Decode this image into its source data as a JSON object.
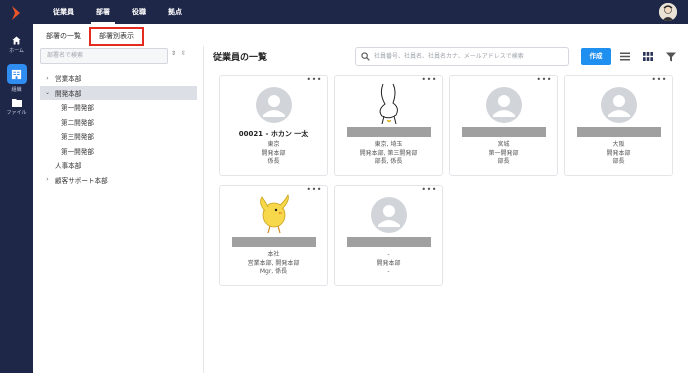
{
  "rail": {
    "items": [
      {
        "label": "ホーム",
        "icon": "home-icon"
      },
      {
        "label": "組織",
        "icon": "org-icon"
      },
      {
        "label": "ファイル",
        "icon": "folder-icon"
      }
    ]
  },
  "topnav": {
    "tabs": [
      "従業員",
      "部署",
      "役職",
      "拠点"
    ],
    "active": "部署"
  },
  "subtabs": {
    "list": "部署の一覧",
    "by_dept": "部署別表示"
  },
  "dept_search": {
    "placeholder": "部署名で検索"
  },
  "tree": [
    {
      "label": "営業本部",
      "expand": "›"
    },
    {
      "label": "開発本部",
      "expand": "⌄"
    },
    {
      "label": "第一開発部"
    },
    {
      "label": "第二開発部"
    },
    {
      "label": "第三開発部"
    },
    {
      "label": "第一開発部"
    },
    {
      "label": "人事本部"
    },
    {
      "label": "顧客サポート本部",
      "expand": "›"
    }
  ],
  "main": {
    "title": "従業員の一覧",
    "search_placeholder": "社員番号、社員名、社員名カナ、メールアドレスで検索",
    "create_label": "作成"
  },
  "cards": [
    {
      "name": "00021 - ホカン 一太",
      "lines": [
        "東京",
        "開発本部",
        "係長"
      ],
      "avatar": "placeholder"
    },
    {
      "lines": [
        "東京, 埼玉",
        "開発本部, 第三開発部",
        "部長, 係長"
      ],
      "avatar": "illustration-figure"
    },
    {
      "lines": [
        "宮城",
        "第一開発部",
        "部長"
      ],
      "avatar": "placeholder"
    },
    {
      "lines": [
        "大阪",
        "開発本部",
        "部長"
      ],
      "avatar": "placeholder"
    },
    {
      "lines": [
        "本社",
        "営業本部, 開発本部",
        "Mgr, 係長"
      ],
      "avatar": "illustration-chick"
    },
    {
      "lines": [
        "-",
        "開発本部",
        "-"
      ],
      "avatar": "placeholder"
    }
  ],
  "colors": {
    "nav_bg": "#1f2749",
    "accent": "#1f8ff0",
    "highlight_box": "#e32b20",
    "logo": "#e8542a"
  }
}
